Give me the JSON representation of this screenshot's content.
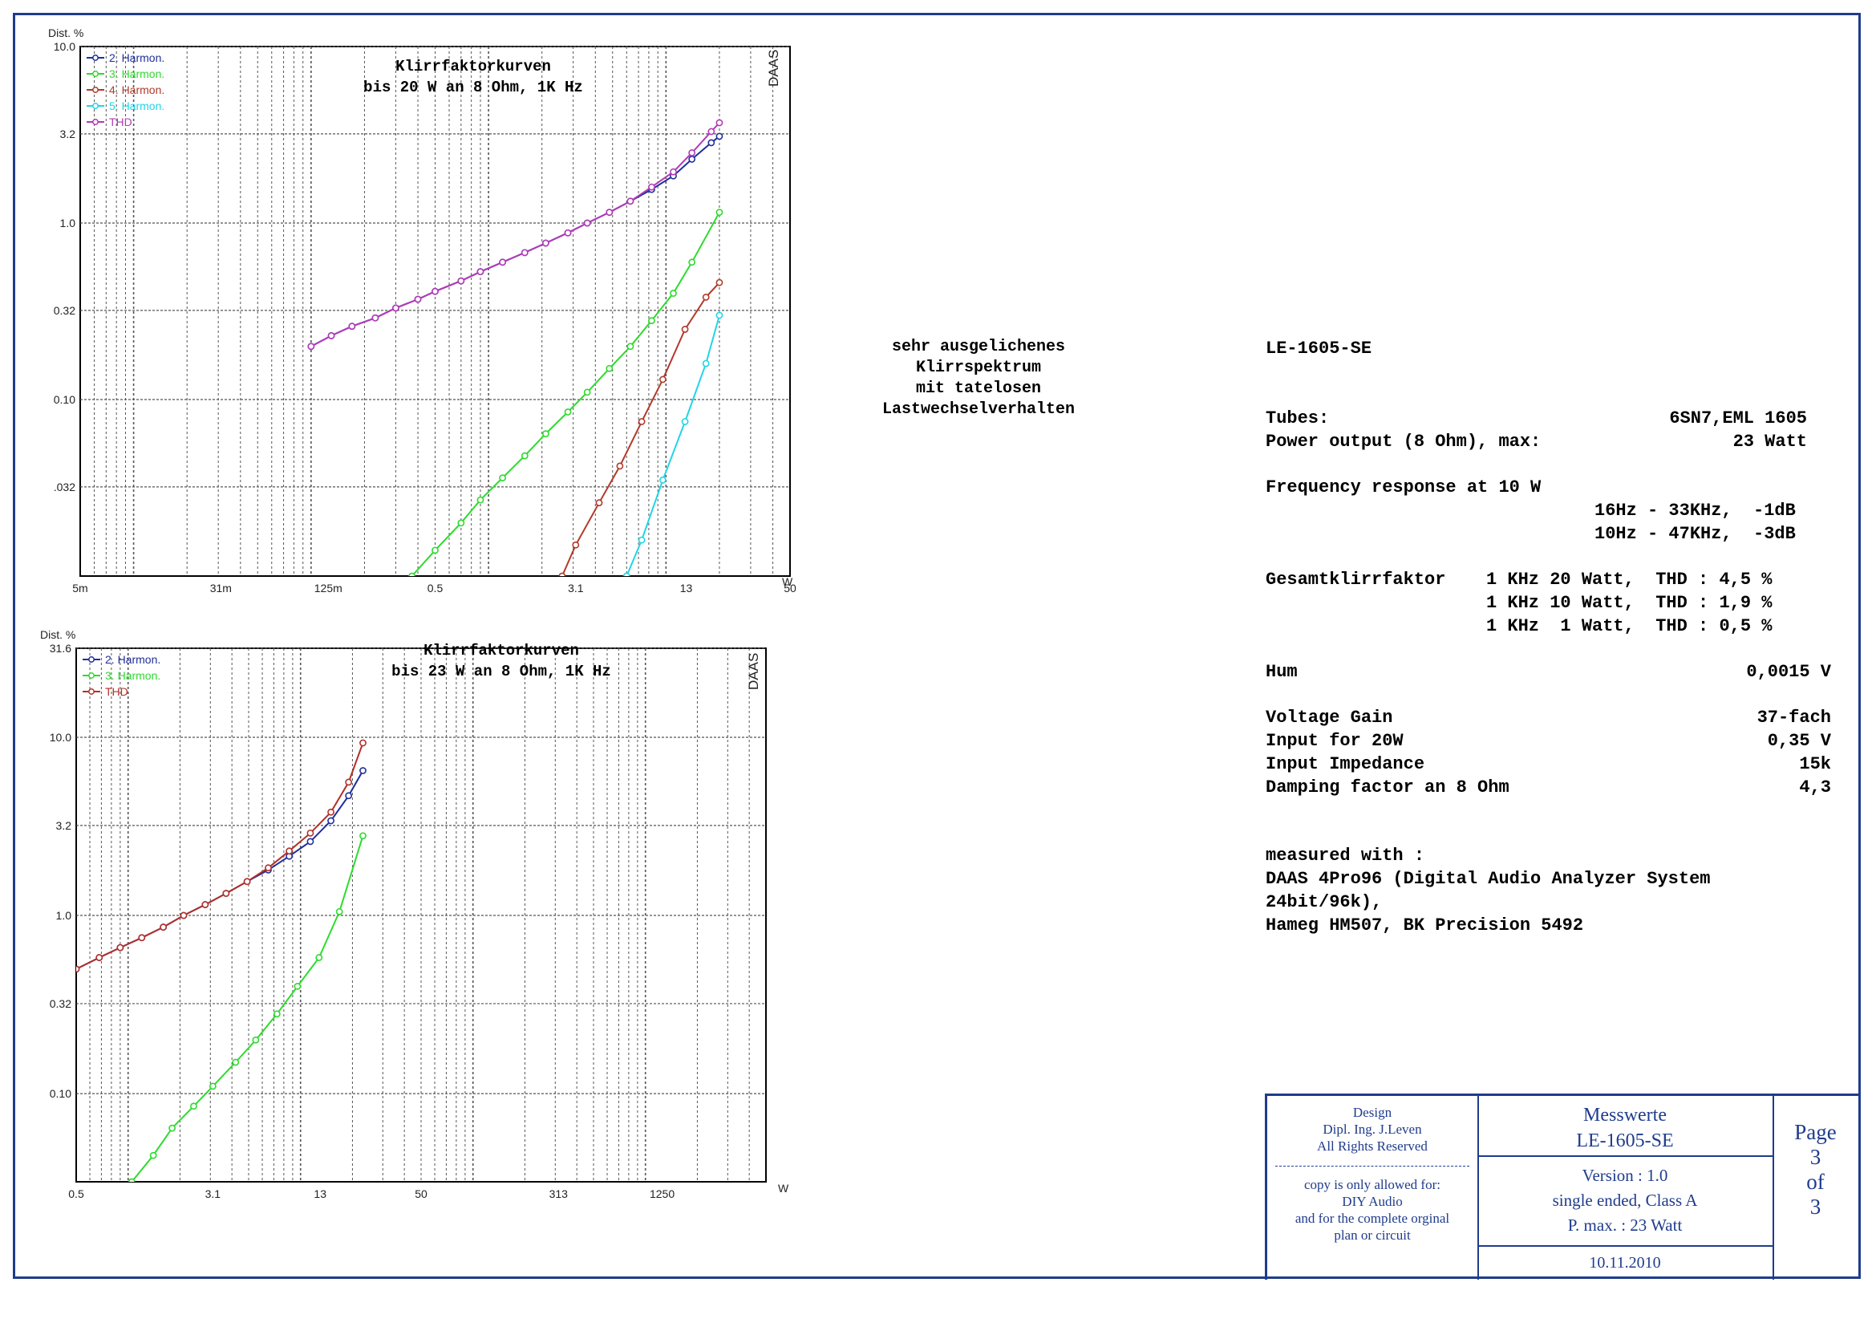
{
  "colors": {
    "frame": "#1f3c8c",
    "h2": "#1f2f9c",
    "h3": "#2ddb2d",
    "h4": "#b23a2a",
    "h5": "#22d4e6",
    "thd": "#b23ab8",
    "thd2": "#b2302a"
  },
  "chart_data": [
    {
      "type": "line",
      "title": "Klirrfaktorkurven",
      "subtitle": "bis 20 W an 8 Ohm, 1K Hz",
      "ylabel": "Dist. %",
      "xlabel": "W",
      "badge": "DAAS",
      "xscale": "log",
      "yscale": "log",
      "xlim": [
        0.005,
        50
      ],
      "ylim": [
        0.01,
        10.0
      ],
      "yticks": [
        {
          "v": 10.0,
          "label": "10.0"
        },
        {
          "v": 3.2,
          "label": "3.2"
        },
        {
          "v": 1.0,
          "label": "1.0"
        },
        {
          "v": 0.32,
          "label": "0.32"
        },
        {
          "v": 0.1,
          "label": "0.10"
        },
        {
          "v": 0.032,
          "label": ".032"
        }
      ],
      "xticks": [
        {
          "v": 0.005,
          "label": "5m"
        },
        {
          "v": 0.031,
          "label": "31m"
        },
        {
          "v": 0.125,
          "label": "125m"
        },
        {
          "v": 0.5,
          "label": "0.5"
        },
        {
          "v": 3.1,
          "label": "3.1"
        },
        {
          "v": 13,
          "label": "13"
        },
        {
          "v": 50,
          "label": "50"
        }
      ],
      "grid": true,
      "legend_position": "top-left",
      "series": [
        {
          "name": "2. Harmon.",
          "color_key": "h2",
          "x": [
            0.1,
            0.13,
            0.17,
            0.23,
            0.3,
            0.4,
            0.5,
            0.7,
            0.9,
            1.2,
            1.6,
            2.1,
            2.8,
            3.6,
            4.8,
            6.3,
            8.3,
            11,
            14,
            18,
            20
          ],
          "y": [
            0.2,
            0.23,
            0.26,
            0.29,
            0.33,
            0.37,
            0.41,
            0.47,
            0.53,
            0.6,
            0.68,
            0.77,
            0.88,
            1.0,
            1.15,
            1.33,
            1.55,
            1.85,
            2.3,
            2.85,
            3.1
          ]
        },
        {
          "name": "3. Harmon.",
          "color_key": "h3",
          "x": [
            0.37,
            0.5,
            0.7,
            0.9,
            1.2,
            1.6,
            2.1,
            2.8,
            3.6,
            4.8,
            6.3,
            8.3,
            11,
            14,
            20
          ],
          "y": [
            0.01,
            0.014,
            0.02,
            0.027,
            0.036,
            0.048,
            0.064,
            0.085,
            0.11,
            0.15,
            0.2,
            0.28,
            0.4,
            0.6,
            1.15
          ]
        },
        {
          "name": "4. Harmon.",
          "color_key": "h4",
          "x": [
            2.6,
            3.1,
            4.2,
            5.5,
            7.3,
            9.6,
            12.8,
            16.8,
            20
          ],
          "y": [
            0.01,
            0.015,
            0.026,
            0.042,
            0.075,
            0.13,
            0.25,
            0.38,
            0.46
          ]
        },
        {
          "name": "5. Harmon.",
          "color_key": "h5",
          "x": [
            6.0,
            7.3,
            9.6,
            12.8,
            16.8,
            20
          ],
          "y": [
            0.01,
            0.016,
            0.035,
            0.075,
            0.16,
            0.3
          ]
        },
        {
          "name": "THD",
          "color_key": "thd",
          "x": [
            0.1,
            0.13,
            0.17,
            0.23,
            0.3,
            0.4,
            0.5,
            0.7,
            0.9,
            1.2,
            1.6,
            2.1,
            2.8,
            3.6,
            4.8,
            6.3,
            8.3,
            11,
            14,
            18,
            20
          ],
          "y": [
            0.2,
            0.23,
            0.26,
            0.29,
            0.33,
            0.37,
            0.41,
            0.47,
            0.53,
            0.6,
            0.68,
            0.77,
            0.88,
            1.0,
            1.15,
            1.33,
            1.6,
            1.95,
            2.5,
            3.3,
            3.7
          ]
        }
      ]
    },
    {
      "type": "line",
      "title": "Klirrfaktorkurven",
      "subtitle": "bis 23 W an 8 Ohm, 1K Hz",
      "ylabel": "Dist. %",
      "xlabel": "W",
      "badge": "DAAS",
      "xscale": "log",
      "yscale": "log",
      "xlim": [
        0.5,
        5000
      ],
      "ylim": [
        0.032,
        31.6
      ],
      "yticks": [
        {
          "v": 31.6,
          "label": "31.6"
        },
        {
          "v": 10.0,
          "label": "10.0"
        },
        {
          "v": 3.2,
          "label": "3.2"
        },
        {
          "v": 1.0,
          "label": "1.0"
        },
        {
          "v": 0.32,
          "label": "0.32"
        },
        {
          "v": 0.1,
          "label": "0.10"
        }
      ],
      "xticks": [
        {
          "v": 0.5,
          "label": "0.5"
        },
        {
          "v": 3.1,
          "label": "3.1"
        },
        {
          "v": 13,
          "label": "13"
        },
        {
          "v": 50,
          "label": "50"
        },
        {
          "v": 313,
          "label": "313"
        },
        {
          "v": 1250,
          "label": "1250"
        }
      ],
      "grid": true,
      "legend_position": "top-left",
      "series": [
        {
          "name": "2. Harmon.",
          "color_key": "h2",
          "x": [
            0.5,
            0.68,
            0.9,
            1.2,
            1.6,
            2.1,
            2.8,
            3.7,
            4.9,
            6.5,
            8.6,
            11.4,
            15,
            19,
            23
          ],
          "y": [
            0.5,
            0.58,
            0.66,
            0.75,
            0.86,
            1.0,
            1.15,
            1.33,
            1.55,
            1.8,
            2.15,
            2.6,
            3.4,
            4.7,
            6.5
          ]
        },
        {
          "name": "3. Harmon.",
          "color_key": "h3",
          "x": [
            1.05,
            1.4,
            1.8,
            2.4,
            3.1,
            4.2,
            5.5,
            7.3,
            9.6,
            12.8,
            16.8,
            23
          ],
          "y": [
            0.032,
            0.045,
            0.064,
            0.085,
            0.11,
            0.15,
            0.2,
            0.28,
            0.4,
            0.58,
            1.05,
            2.8
          ]
        },
        {
          "name": "THD",
          "color_key": "thd2",
          "x": [
            0.5,
            0.68,
            0.9,
            1.2,
            1.6,
            2.1,
            2.8,
            3.7,
            4.9,
            6.5,
            8.6,
            11.4,
            15,
            19,
            23
          ],
          "y": [
            0.5,
            0.58,
            0.66,
            0.75,
            0.86,
            1.0,
            1.15,
            1.33,
            1.55,
            1.85,
            2.3,
            2.9,
            3.8,
            5.6,
            9.3
          ]
        }
      ]
    }
  ],
  "note": {
    "lines": [
      "sehr ausgelichenes",
      "Klirrspektrum",
      "mit tatelosen",
      "Lastwechselverhalten"
    ]
  },
  "specs": {
    "model": "LE-1605-SE",
    "tubes_label": "Tubes:",
    "tubes_value": "6SN7,EML 1605",
    "power_label": "Power output (8 Ohm), max:",
    "power_value": "23 Watt",
    "freq_label": "Frequency response at 10 W",
    "freq_line1": "16Hz - 33KHz,  -1dB",
    "freq_line2": "10Hz - 47KHz,  -3dB",
    "thd_label": "Gesamtklirrfaktor",
    "thd_line1": "1 KHz 20 Watt,  THD : 4,5 %",
    "thd_line2": "1 KHz 10 Watt,  THD : 1,9 %",
    "thd_line3": "1 KHz  1 Watt,  THD : 0,5 %",
    "hum_label": "Hum",
    "hum_value": "0,0015 V",
    "gain_label": "Voltage Gain",
    "gain_value": "37-fach",
    "input_label": "Input for 20W",
    "input_value": "0,35 V",
    "impedance_label": "Input Impedance",
    "impedance_value": "15k",
    "damping_label": "Damping factor an 8 Ohm",
    "damping_value": "4,3",
    "measured_label": "measured with :",
    "measured_line1": "DAAS 4Pro96 (Digital Audio Analyzer System",
    "measured_line2": "24bit/96k),",
    "measured_line3": "Hameg HM507, BK Precision 5492"
  },
  "titleblock": {
    "design": "Design",
    "designer": "Dipl. Ing. J.Leven",
    "rights": "All Rights Reserved",
    "copy1": "copy is only allowed for:",
    "copy2": "DIY Audio",
    "copy3": "and for the complete orginal",
    "copy4": "plan or circuit",
    "heading": "Messwerte",
    "model": "LE-1605-SE",
    "version": "Version : 1.0",
    "type": "single ended, Class A",
    "pmax": "P. max. : 23 Watt",
    "date": "10.11.2010",
    "page_label": "Page",
    "page_num": "3",
    "of_label": "of",
    "page_total": "3"
  }
}
